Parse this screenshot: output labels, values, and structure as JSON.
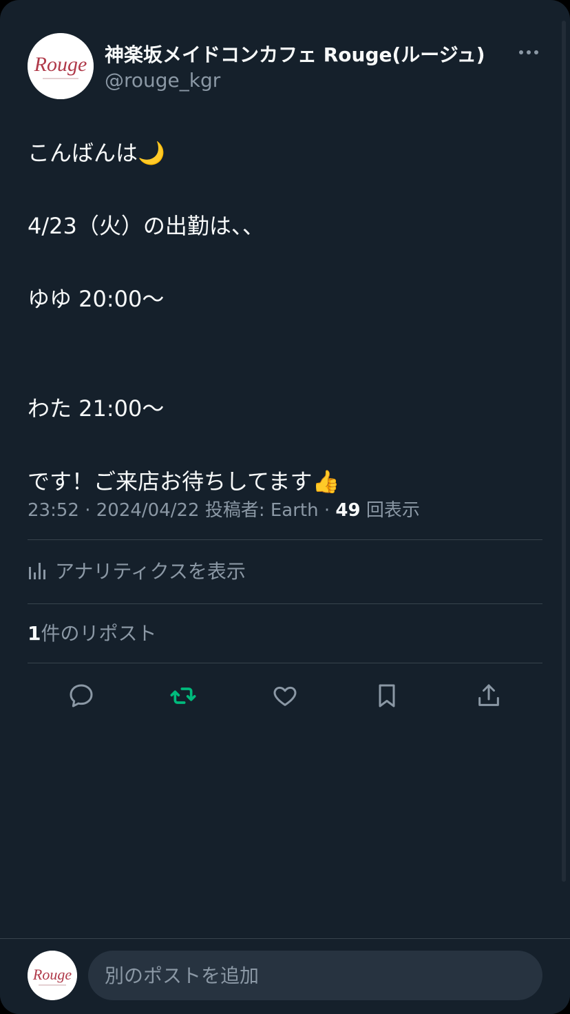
{
  "colors": {
    "background": "#15202b",
    "text_primary": "#f7f9f9",
    "text_secondary": "#8b98a5",
    "divider": "#38444d",
    "repost_active": "#00ba7c",
    "brand_rouge": "#b03a4a"
  },
  "author": {
    "display_name": "神楽坂メイドコンカフェ Rouge(ルージュ)",
    "handle": "@rouge_kgr",
    "avatar_text": "Rouge"
  },
  "post": {
    "lines": [
      "こんばんは🌙",
      "",
      "4/23（火）の出勤は、、",
      "",
      "ゆゆ 20:00〜",
      "",
      "",
      "わた 21:00〜",
      "",
      "です！ご来店お待ちしてます👍"
    ]
  },
  "meta": {
    "time": "23:52",
    "date": "2024/04/22",
    "posted_by_label": "投稿者: Earth",
    "views_count": "49",
    "views_label": "回表示"
  },
  "analytics": {
    "label": "アナリティクスを表示",
    "icon": "bar-chart-icon"
  },
  "reposts": {
    "count": "1",
    "label": "件のリポスト"
  },
  "actions": {
    "reply_icon": "reply-icon",
    "repost_icon": "repost-icon",
    "like_icon": "heart-icon",
    "bookmark_icon": "bookmark-icon",
    "share_icon": "share-icon"
  },
  "composer": {
    "placeholder": "別のポストを追加"
  }
}
